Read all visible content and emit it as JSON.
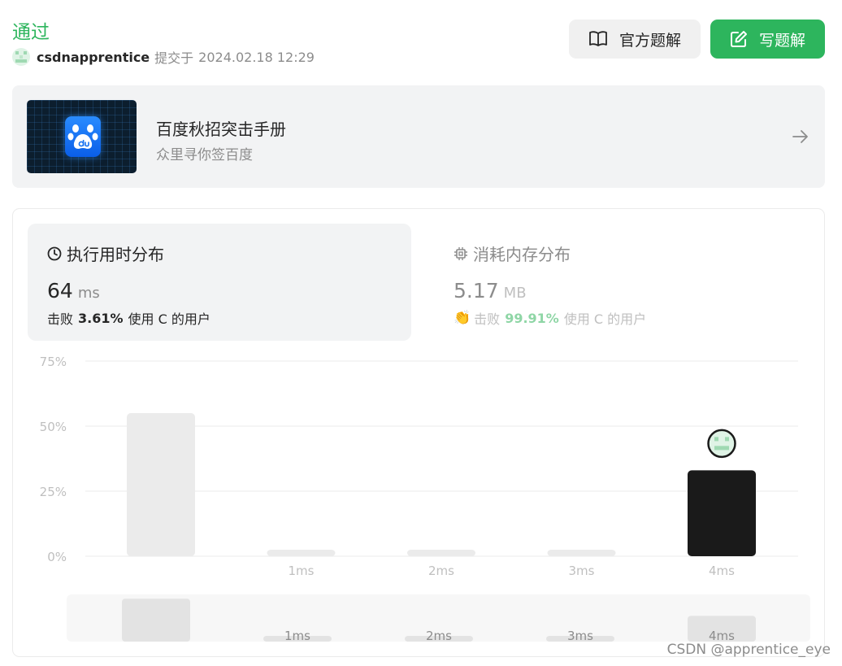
{
  "header": {
    "status": "通过",
    "username": "csdnapprentice",
    "submitted_text": "提交于",
    "submitted_time": "2024.02.18 12:29",
    "official_solution_label": "官方题解",
    "write_solution_label": "写题解"
  },
  "promo": {
    "title": "百度秋招突击手册",
    "subtitle": "众里寻你签百度"
  },
  "runtime": {
    "heading": "执行用时分布",
    "value": "64",
    "unit": "ms",
    "beat_prefix": "击败",
    "beat_percent": "3.61%",
    "beat_suffix": "使用 C 的用户"
  },
  "memory": {
    "heading": "消耗内存分布",
    "value": "5.17",
    "unit": "MB",
    "beat_prefix": "击败",
    "beat_percent": "99.91%",
    "beat_suffix": "使用 C 的用户"
  },
  "chart_data": {
    "type": "bar",
    "categories": [
      "",
      "1ms",
      "2ms",
      "3ms",
      "4ms"
    ],
    "values": [
      55,
      2.5,
      2.5,
      2.5,
      33
    ],
    "y_ticks": [
      "0%",
      "25%",
      "50%",
      "75%"
    ],
    "ylim": [
      0,
      75
    ],
    "highlight_index": 4,
    "grid": true,
    "overview": {
      "categories": [
        "",
        "1ms",
        "2ms",
        "3ms",
        "4ms"
      ],
      "values": [
        55,
        2.5,
        2.5,
        2.5,
        33
      ]
    }
  },
  "watermark": "CSDN @apprentice_eye",
  "colors": {
    "accent_green": "#2db55d",
    "bar_default": "#ebebeb",
    "bar_highlight": "#1a1a1a"
  }
}
